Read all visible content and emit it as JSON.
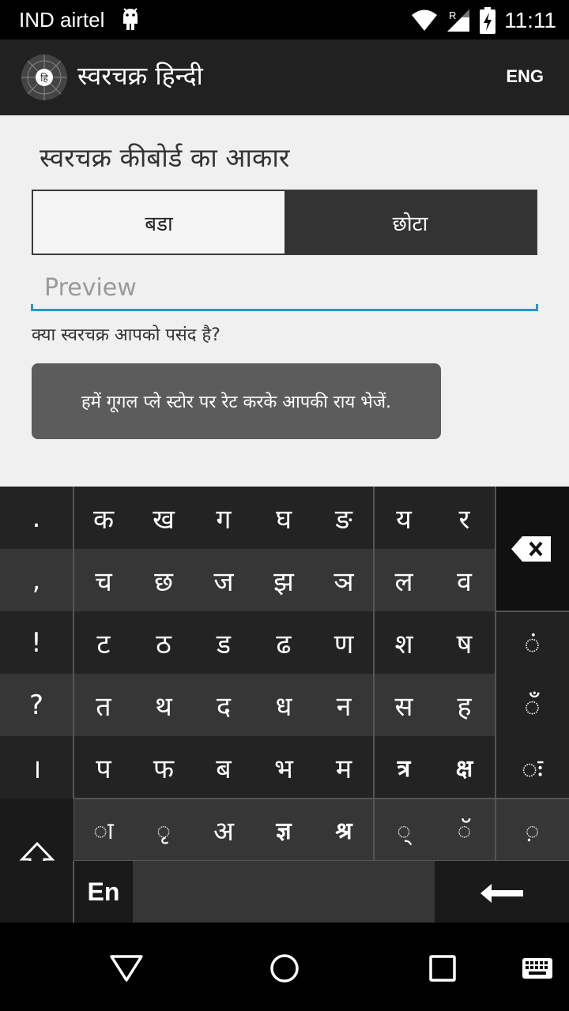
{
  "status_bar": {
    "carrier": "IND airtel",
    "roaming_label": "R",
    "clock": "11:11"
  },
  "app_bar": {
    "logo_glyph": "हि",
    "title": "स्वरचक्र हिन्दी",
    "lang_button": "ENG"
  },
  "content": {
    "heading": "स्वरचक्र कीबोर्ड का आकार",
    "size_toggle": {
      "options": [
        "बडा",
        "छोटा"
      ],
      "selected": "छोटा"
    },
    "preview_placeholder": "Preview",
    "question": "क्या स्वरचक्र आपको पसंद है?",
    "rate_button": "हमें गूगल प्ले स्टोर पर रेट करके आपकी राय भेजें."
  },
  "keyboard": {
    "punct": [
      ".",
      ",",
      "!",
      "?",
      "।"
    ],
    "consonant_rows": [
      [
        "क",
        "ख",
        "ग",
        "घ",
        "ङ",
        "य",
        "र"
      ],
      [
        "च",
        "छ",
        "ज",
        "झ",
        "ञ",
        "ल",
        "व"
      ],
      [
        "ट",
        "ठ",
        "ड",
        "ढ",
        "ण",
        "श",
        "ष"
      ],
      [
        "त",
        "थ",
        "द",
        "ध",
        "न",
        "स",
        "ह"
      ],
      [
        "प",
        "फ",
        "ब",
        "भ",
        "म",
        "त्र",
        "क्ष"
      ]
    ],
    "sign_row": [
      "◌ा",
      "◌ृ",
      "अ",
      "ज्ञ",
      "श्र",
      "◌्",
      "◌ॅ",
      "◌़"
    ],
    "right_signs": [
      "◌ं",
      "◌ँ",
      "◌ः"
    ],
    "lang_key": "En"
  },
  "colors": {
    "accent": "#2a96c6",
    "app_bar": "#212121",
    "keyboard_dark": "#232323",
    "keyboard_light": "#363636"
  }
}
